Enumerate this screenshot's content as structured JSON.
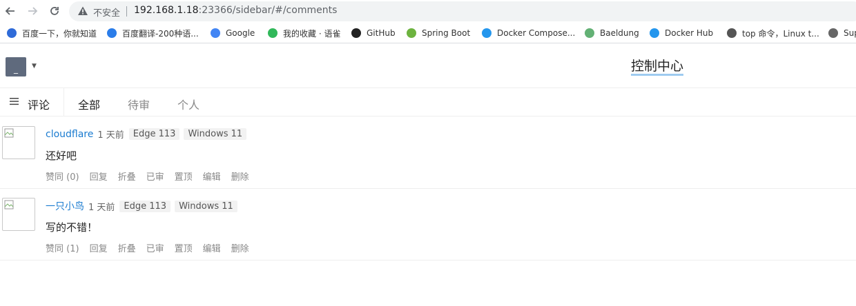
{
  "browser": {
    "security_label": "不安全",
    "url_host": "192.168.1.18",
    "url_rest": ":23366/sidebar/#/comments",
    "bookmarks": [
      {
        "label": "百度一下，你就知道",
        "icon": "baidu-paw-icon",
        "color": "#2f6bd8"
      },
      {
        "label": "百度翻译-200种语...",
        "icon": "translate-icon",
        "color": "#2b7de9"
      },
      {
        "label": "Google",
        "icon": "google-icon",
        "color": "#4285f4"
      },
      {
        "label": "我的收藏 · 语雀",
        "icon": "yuque-icon",
        "color": "#31b85a"
      },
      {
        "label": "GitHub",
        "icon": "github-icon",
        "color": "#222222"
      },
      {
        "label": "Spring Boot",
        "icon": "spring-icon",
        "color": "#6db33f"
      },
      {
        "label": "Docker Compose...",
        "icon": "docker-icon",
        "color": "#2496ed"
      },
      {
        "label": "Baeldung",
        "icon": "baeldung-icon",
        "color": "#63b175"
      },
      {
        "label": "Docker Hub",
        "icon": "dockerhub-icon",
        "color": "#2496ed"
      },
      {
        "label": "top 命令，Linux t...",
        "icon": "linux-tux-icon",
        "color": "#555555"
      },
      {
        "label": "Sup",
        "icon": "globe-icon",
        "color": "#666666"
      }
    ]
  },
  "header": {
    "avatar_text": "_",
    "title": "控制中心"
  },
  "tabs_bar": {
    "menu_title": "评论",
    "tabs": [
      {
        "label": "全部",
        "active": true
      },
      {
        "label": "待审",
        "active": false
      },
      {
        "label": "个人",
        "active": false
      }
    ]
  },
  "comments": [
    {
      "author": "cloudflare",
      "time": "1 天前",
      "browser": "Edge 113",
      "os": "Windows 11",
      "content": "还好吧",
      "actions": [
        "赞同 (0)",
        "回复",
        "折叠",
        "已审",
        "置顶",
        "编辑",
        "删除"
      ]
    },
    {
      "author": "一只小鸟",
      "time": "1 天前",
      "browser": "Edge 113",
      "os": "Windows 11",
      "content": "写的不错！",
      "actions": [
        "赞同 (1)",
        "回复",
        "折叠",
        "已审",
        "置顶",
        "编辑",
        "删除"
      ]
    }
  ]
}
